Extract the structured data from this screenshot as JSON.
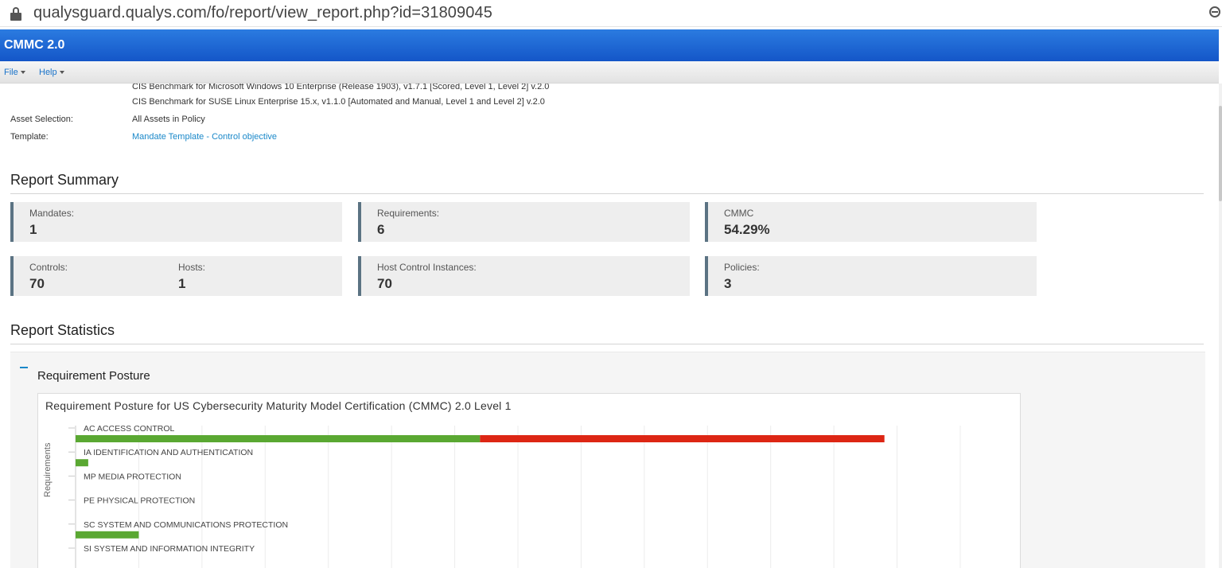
{
  "browser": {
    "url": "qualysguard.qualys.com/fo/report/view_report.php?id=31809045",
    "lock_icon": "lock-icon",
    "zoom_icon": "zoom-out-icon"
  },
  "app": {
    "title": "CMMC 2.0"
  },
  "menu": {
    "file": "File",
    "help": "Help"
  },
  "benchmarks": [
    "CIS Benchmark for Microsoft Windows 10 Enterprise (Release 1903), v1.7.1 [Scored, Level 1, Level 2] v.2.0",
    "CIS Benchmark for SUSE Linux Enterprise 15.x, v1.1.0 [Automated and Manual, Level 1 and Level 2] v.2.0"
  ],
  "meta": {
    "asset_selection_label": "Asset Selection:",
    "asset_selection_value": "All Assets in Policy",
    "template_label": "Template:",
    "template_value": "Mandate Template - Control objective"
  },
  "summary": {
    "title": "Report Summary",
    "mandates_label": "Mandates:",
    "mandates_value": "1",
    "requirements_label": "Requirements:",
    "requirements_value": "6",
    "cmmc_label": "CMMC",
    "cmmc_value": "54.29%",
    "controls_label": "Controls:",
    "controls_value": "70",
    "hosts_label": "Hosts:",
    "hosts_value": "1",
    "hci_label": "Host Control Instances:",
    "hci_value": "70",
    "policies_label": "Policies:",
    "policies_value": "3"
  },
  "statistics": {
    "title": "Report Statistics",
    "posture_title": "Requirement Posture"
  },
  "colors": {
    "pass": "#5aa832",
    "fail": "#dd2614",
    "accent": "#1a88c9",
    "header": "#1e63d2"
  },
  "chart_data": {
    "type": "bar",
    "orientation": "horizontal",
    "stacked": true,
    "title": "Requirement Posture for US Cybersecurity Maturity Model Certification (CMMC) 2.0 Level 1",
    "ylabel": "Requirements",
    "categories": [
      "AC ACCESS CONTROL",
      "IA IDENTIFICATION AND AUTHENTICATION",
      "MP MEDIA PROTECTION",
      "PE PHYSICAL PROTECTION",
      "SC SYSTEM AND COMMUNICATIONS PROTECTION",
      "SI SYSTEM AND INFORMATION INTEGRITY"
    ],
    "series": [
      {
        "color": "#5aa832",
        "values": [
          32,
          1,
          0,
          0,
          5,
          0
        ]
      },
      {
        "color": "#dd2614",
        "values": [
          32,
          0,
          0,
          0,
          0,
          0
        ]
      }
    ],
    "xlim": [
      0,
      70
    ],
    "grid": true
  }
}
